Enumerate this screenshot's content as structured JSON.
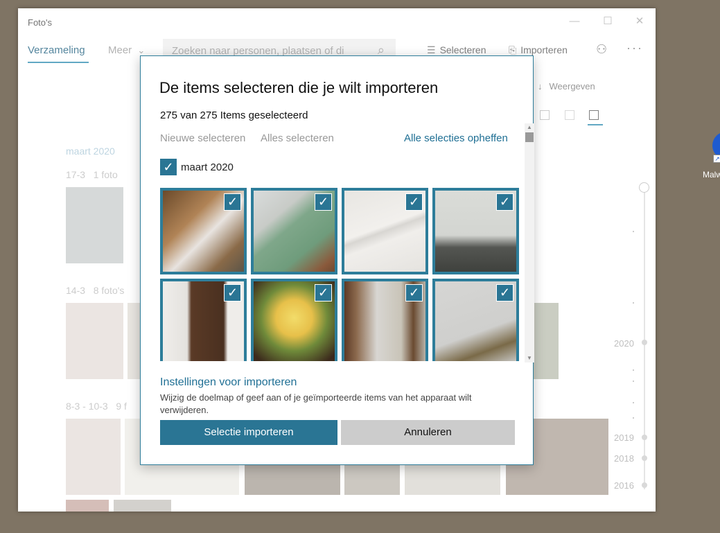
{
  "app": {
    "title": "Foto's"
  },
  "window_controls": {
    "minimize": "—",
    "maximize": "☐",
    "close": "✕"
  },
  "toolbar": {
    "tab_collection": "Verzameling",
    "tab_more": "Meer",
    "tab_more_chevron": "⌄",
    "search_placeholder": "Zoeken naar personen, plaatsen of di",
    "select_label": "Selecteren",
    "import_label": "Importeren"
  },
  "view": {
    "label": "Weergeven"
  },
  "background_groups": [
    {
      "title": "maart 2020"
    },
    {
      "date": "17-3",
      "count": "1 foto"
    },
    {
      "date": "14-3",
      "count": "8 foto's"
    },
    {
      "date": "8-3 - 10-3",
      "count": "9 f"
    }
  ],
  "timeline": {
    "years": [
      "2020",
      "2019",
      "2018",
      "2016"
    ]
  },
  "desktop_icon": {
    "label": "Malw"
  },
  "dialog": {
    "title": "De items selecteren die je wilt importeren",
    "count_text": "275 van 275 Items geselecteerd",
    "select_new": "Nieuwe selecteren",
    "select_all": "Alles selecteren",
    "deselect_all": "Alle selecties opheffen",
    "group_label": "maart 2020",
    "group_checked": true,
    "settings_title": "Instellingen voor importeren",
    "settings_desc": "Wijzig de doelmap of geef aan of je geïmporteerde items van het apparaat wilt verwijderen.",
    "primary_button": "Selectie importeren",
    "secondary_button": "Annuleren"
  },
  "photos_selected": [
    true,
    true,
    true,
    true,
    true,
    true,
    true,
    true
  ],
  "colors": {
    "accent": "#2a7594",
    "link": "#1f6f94",
    "border": "#2d7d9a"
  }
}
